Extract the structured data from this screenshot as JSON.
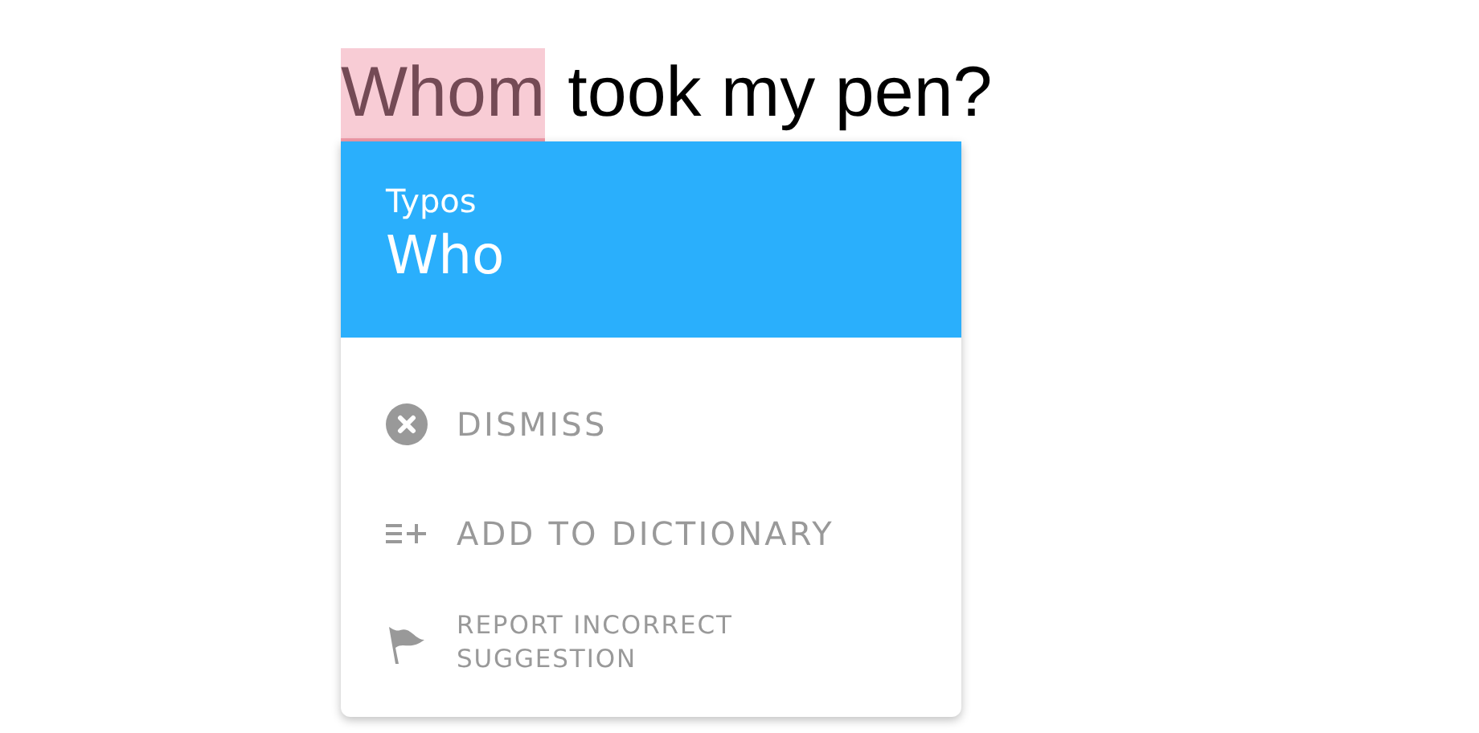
{
  "sentence": {
    "flagged_word": "Whom",
    "rest": "took my pen?"
  },
  "popup": {
    "category": "Typos",
    "suggestion": "Who",
    "actions": [
      {
        "kind": "dismiss",
        "label": "DISMISS"
      },
      {
        "kind": "add",
        "label": "ADD TO DICTIONARY"
      },
      {
        "kind": "report",
        "label": "REPORT INCORRECT SUGGESTION"
      }
    ]
  }
}
